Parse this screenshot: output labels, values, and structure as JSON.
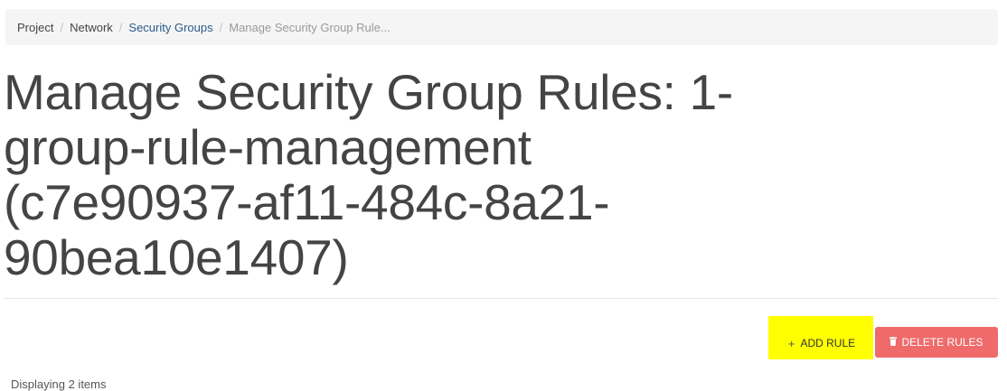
{
  "breadcrumb": {
    "items": [
      {
        "label": "Project"
      },
      {
        "label": "Network"
      },
      {
        "label": "Security Groups"
      },
      {
        "label": "Manage Security Group Rule..."
      }
    ],
    "separator": "/"
  },
  "header": {
    "title_lines": [
      "Manage Security Group Rules: 1-",
      "group-rule-management",
      "(c7e90937-af11-484c-8a21-",
      "90bea10e1407)"
    ]
  },
  "actions": {
    "add_rule_icon": "+",
    "add_rule_label": "ADD RULE",
    "delete_rules_label": "DELETE RULES",
    "delete_icon": "trash-icon",
    "delete_color": "#ef6b6b",
    "highlight_color": "#ffff00"
  },
  "table": {
    "count_text": "Displaying 2 items"
  }
}
